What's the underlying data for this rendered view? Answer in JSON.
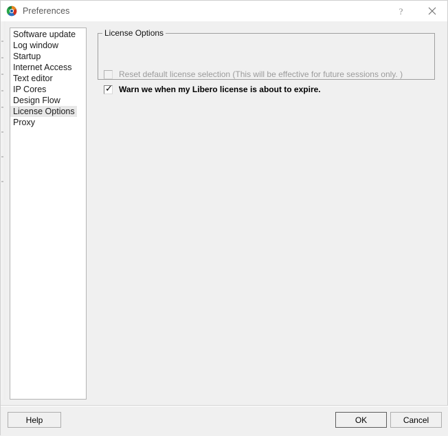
{
  "window": {
    "title": "Preferences",
    "icon": "libero-app-icon",
    "controls": {
      "help": "?",
      "close": "close-icon"
    }
  },
  "sidebar": {
    "items": [
      {
        "label": "Software update",
        "selected": false
      },
      {
        "label": "Log window",
        "selected": false
      },
      {
        "label": "Startup",
        "selected": false
      },
      {
        "label": "Internet Access",
        "selected": false
      },
      {
        "label": "Text editor",
        "selected": false
      },
      {
        "label": "IP Cores",
        "selected": false
      },
      {
        "label": "Design Flow",
        "selected": false
      },
      {
        "label": "License Options",
        "selected": true
      },
      {
        "label": "Proxy",
        "selected": false
      }
    ]
  },
  "main": {
    "groupbox": {
      "title": "License Options",
      "checkboxes": [
        {
          "label": "Reset default license selection (This will be effective for future sessions only. )",
          "checked": false,
          "disabled": true
        },
        {
          "label": "Warn we when my Libero license is about to expire.",
          "checked": true,
          "disabled": false
        }
      ]
    }
  },
  "footer": {
    "help_label": "Help",
    "ok_label": "OK",
    "cancel_label": "Cancel"
  },
  "colors": {
    "dialog_background": "#f0f0f0",
    "titlebar_background": "#ffffff",
    "list_background": "#ffffff",
    "selection_highlight": "#e8e8e8",
    "disabled_text": "#9b9b9b",
    "border": "#9f9f9f"
  }
}
